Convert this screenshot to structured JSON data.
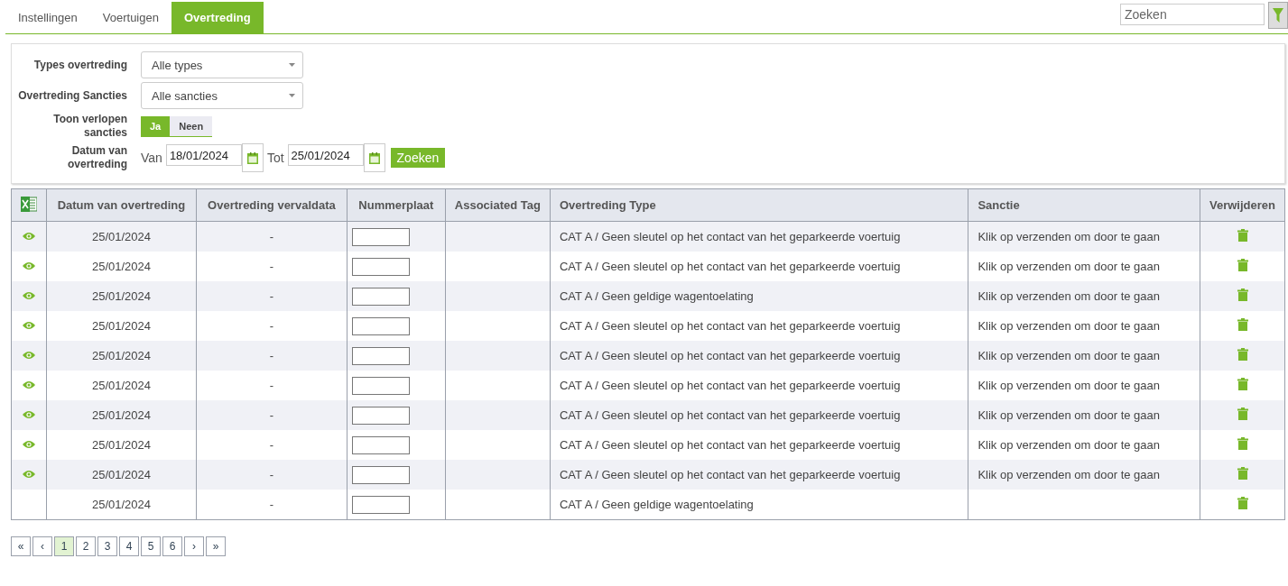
{
  "tabs": [
    {
      "label": "Instellingen",
      "selected": false
    },
    {
      "label": "Voertuigen",
      "selected": false
    },
    {
      "label": "Overtreding",
      "selected": true
    }
  ],
  "search": {
    "placeholder": "Zoeken"
  },
  "filters": {
    "types": {
      "label": "Types overtreding",
      "value": "Alle types"
    },
    "sancties": {
      "label": "Overtreding Sancties",
      "value": "Alle sancties"
    },
    "expired": {
      "label": "Toon verlopen sancties",
      "options": [
        {
          "label": "Ja",
          "selected": true
        },
        {
          "label": "Neen",
          "selected": false
        }
      ]
    },
    "date": {
      "label": "Datum van overtreding",
      "from_label": "Van",
      "from": "18/01/2024",
      "to_label": "Tot",
      "to": "25/01/2024",
      "button": "Zoeken"
    }
  },
  "table": {
    "columns": [
      "Datum van overtreding",
      "Overtreding vervaldata",
      "Nummerplaat",
      "Associated Tag",
      "Overtreding Type",
      "Sanctie",
      "Verwijderen"
    ],
    "rows": [
      {
        "viewable": true,
        "date": "25/01/2024",
        "expiry": "-",
        "type": "CAT A / Geen sleutel op het contact van het geparkeerde voertuig",
        "sanction": "Klik op verzenden om door te gaan"
      },
      {
        "viewable": true,
        "date": "25/01/2024",
        "expiry": "-",
        "type": "CAT A / Geen sleutel op het contact van het geparkeerde voertuig",
        "sanction": "Klik op verzenden om door te gaan"
      },
      {
        "viewable": true,
        "date": "25/01/2024",
        "expiry": "-",
        "type": "CAT A / Geen geldige wagentoelating",
        "sanction": "Klik op verzenden om door te gaan"
      },
      {
        "viewable": true,
        "date": "25/01/2024",
        "expiry": "-",
        "type": "CAT A / Geen sleutel op het contact van het geparkeerde voertuig",
        "sanction": "Klik op verzenden om door te gaan"
      },
      {
        "viewable": true,
        "date": "25/01/2024",
        "expiry": "-",
        "type": "CAT A / Geen sleutel op het contact van het geparkeerde voertuig",
        "sanction": "Klik op verzenden om door te gaan"
      },
      {
        "viewable": true,
        "date": "25/01/2024",
        "expiry": "-",
        "type": "CAT A / Geen sleutel op het contact van het geparkeerde voertuig",
        "sanction": "Klik op verzenden om door te gaan"
      },
      {
        "viewable": true,
        "date": "25/01/2024",
        "expiry": "-",
        "type": "CAT A / Geen sleutel op het contact van het geparkeerde voertuig",
        "sanction": "Klik op verzenden om door te gaan"
      },
      {
        "viewable": true,
        "date": "25/01/2024",
        "expiry": "-",
        "type": "CAT A / Geen sleutel op het contact van het geparkeerde voertuig",
        "sanction": "Klik op verzenden om door te gaan"
      },
      {
        "viewable": true,
        "date": "25/01/2024",
        "expiry": "-",
        "type": "CAT A / Geen sleutel op het contact van het geparkeerde voertuig",
        "sanction": "Klik op verzenden om door te gaan"
      },
      {
        "viewable": false,
        "date": "25/01/2024",
        "expiry": "-",
        "type": "CAT A / Geen geldige wagentoelating"
      }
    ]
  },
  "pagination": [
    {
      "label": "«",
      "selected": false
    },
    {
      "label": "‹",
      "selected": false
    },
    {
      "label": "1",
      "selected": true
    },
    {
      "label": "2",
      "selected": false
    },
    {
      "label": "3",
      "selected": false
    },
    {
      "label": "4",
      "selected": false
    },
    {
      "label": "5",
      "selected": false
    },
    {
      "label": "6",
      "selected": false
    },
    {
      "label": "›",
      "selected": false
    },
    {
      "label": "»",
      "selected": false
    }
  ]
}
